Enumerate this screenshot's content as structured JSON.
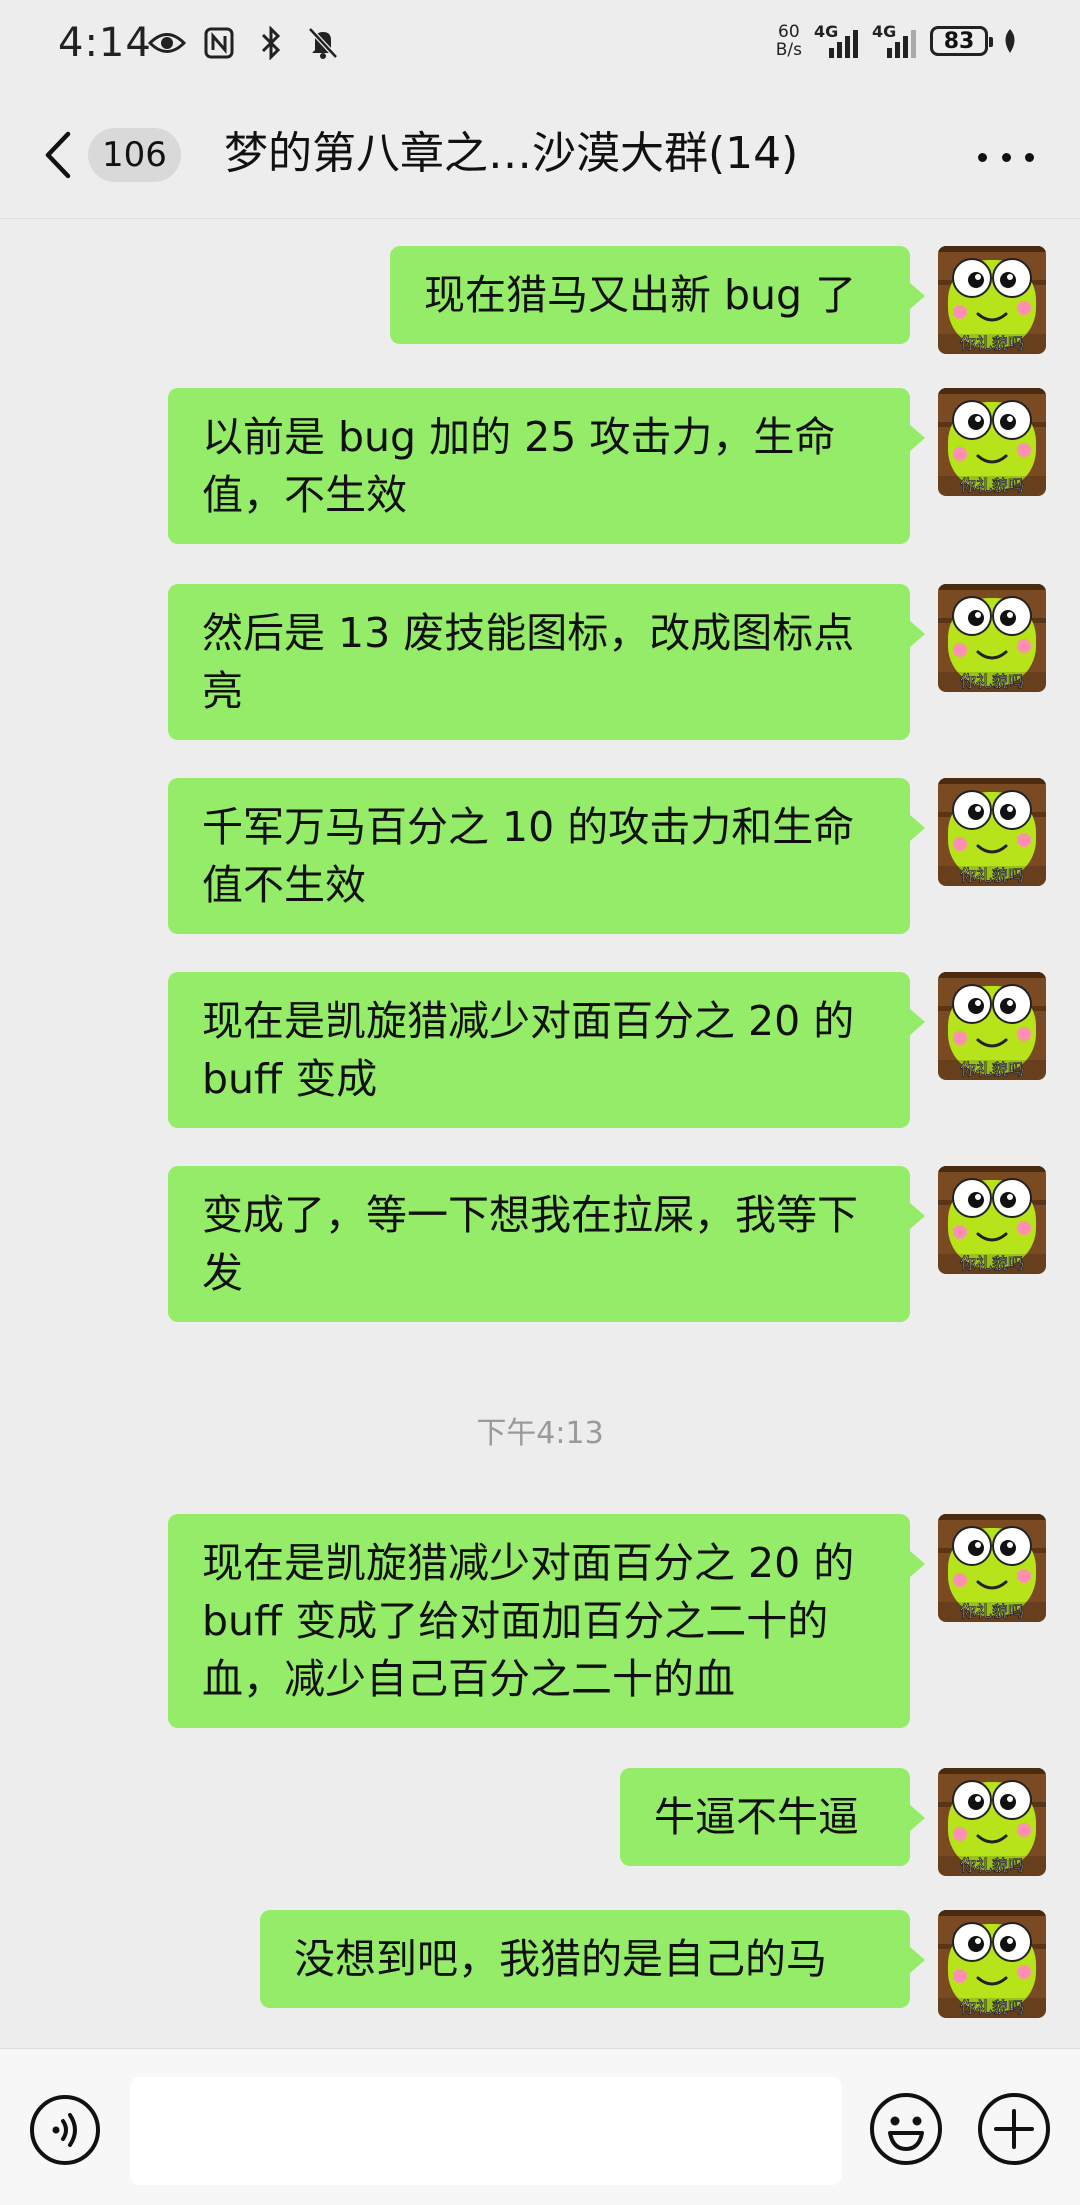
{
  "status_bar": {
    "time": "4:14",
    "net_speed_value": "60",
    "net_speed_unit": "B/s",
    "signal1_label": "4G",
    "signal2_label": "4G",
    "battery": "83"
  },
  "header": {
    "unread_count": "106",
    "title": "梦的第八章之…沙漠大群(14)"
  },
  "avatar": {
    "caption": "你礼貌吗",
    "accent_color": "#95ec69"
  },
  "messages": [
    {
      "text": "现在猎马又出新 bug 了"
    },
    {
      "text": "以前是 bug 加的 25 攻击力，生命值，不生效"
    },
    {
      "text": "然后是 13 废技能图标，改成图标点亮"
    },
    {
      "text": "千军万马百分之 10 的攻击力和生命值不生效"
    },
    {
      "text": "现在是凯旋猎减少对面百分之 20 的 buff 变成"
    },
    {
      "text": "变成了，等一下想我在拉屎，我等下发"
    },
    {
      "text": "现在是凯旋猎减少对面百分之 20 的 buff 变成了给对面加百分之二十的血，减少自己百分之二十的血"
    },
    {
      "text": "牛逼不牛逼"
    },
    {
      "text": "没想到吧，我猎的是自己的马"
    }
  ],
  "timestamp": "下午4:13"
}
